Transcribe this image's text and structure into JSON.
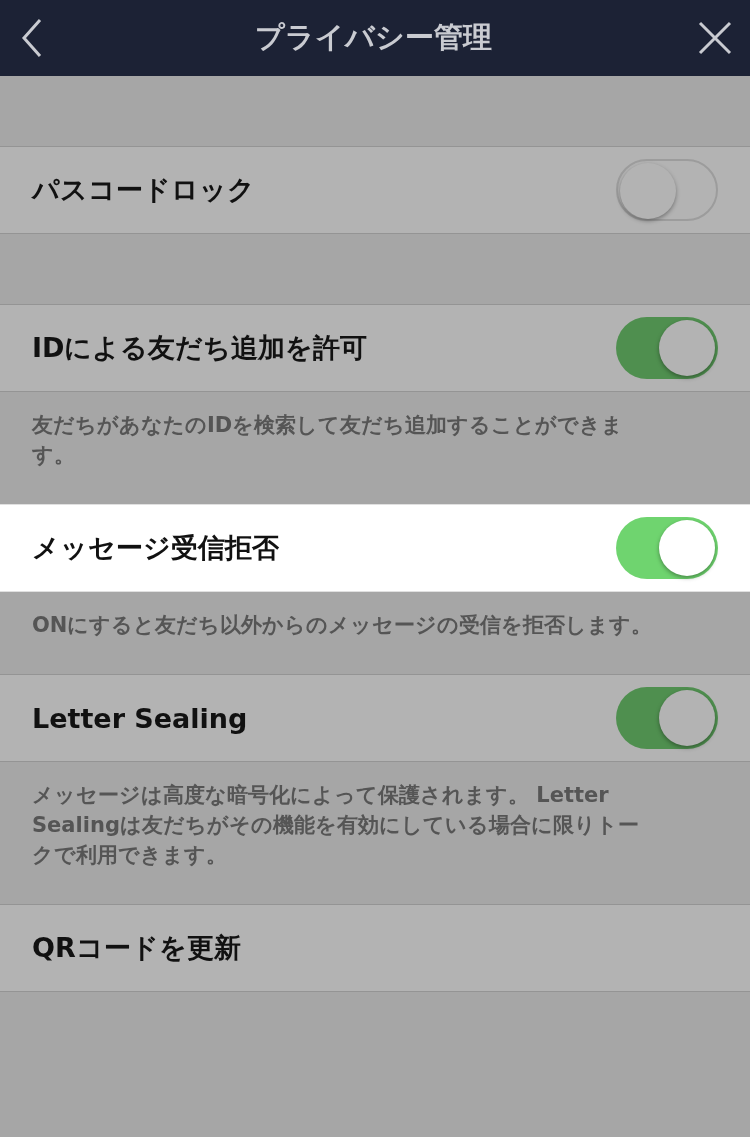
{
  "header": {
    "title": "プライバシー管理"
  },
  "rows": [
    {
      "label": "パスコードロック",
      "kind": "toggle",
      "on": false,
      "highlighted": false
    },
    {
      "label": "IDによる友だち追加を許可",
      "kind": "toggle",
      "on": true,
      "highlighted": false,
      "description": "友だちがあなたのIDを検索して友だち追加することができます。"
    },
    {
      "label": "メッセージ受信拒否",
      "kind": "toggle",
      "on": true,
      "highlighted": true,
      "description": "ONにすると友だち以外からのメッセージの受信を拒否します。"
    },
    {
      "label": "Letter Sealing",
      "kind": "toggle",
      "on": true,
      "highlighted": false,
      "description": "メッセージは高度な暗号化によって保護されます。 Letter Sealingは友だちがその機能を有効にしている場合に限りトークで利用できます。"
    },
    {
      "label": "QRコードを更新",
      "kind": "link",
      "highlighted": false
    }
  ]
}
